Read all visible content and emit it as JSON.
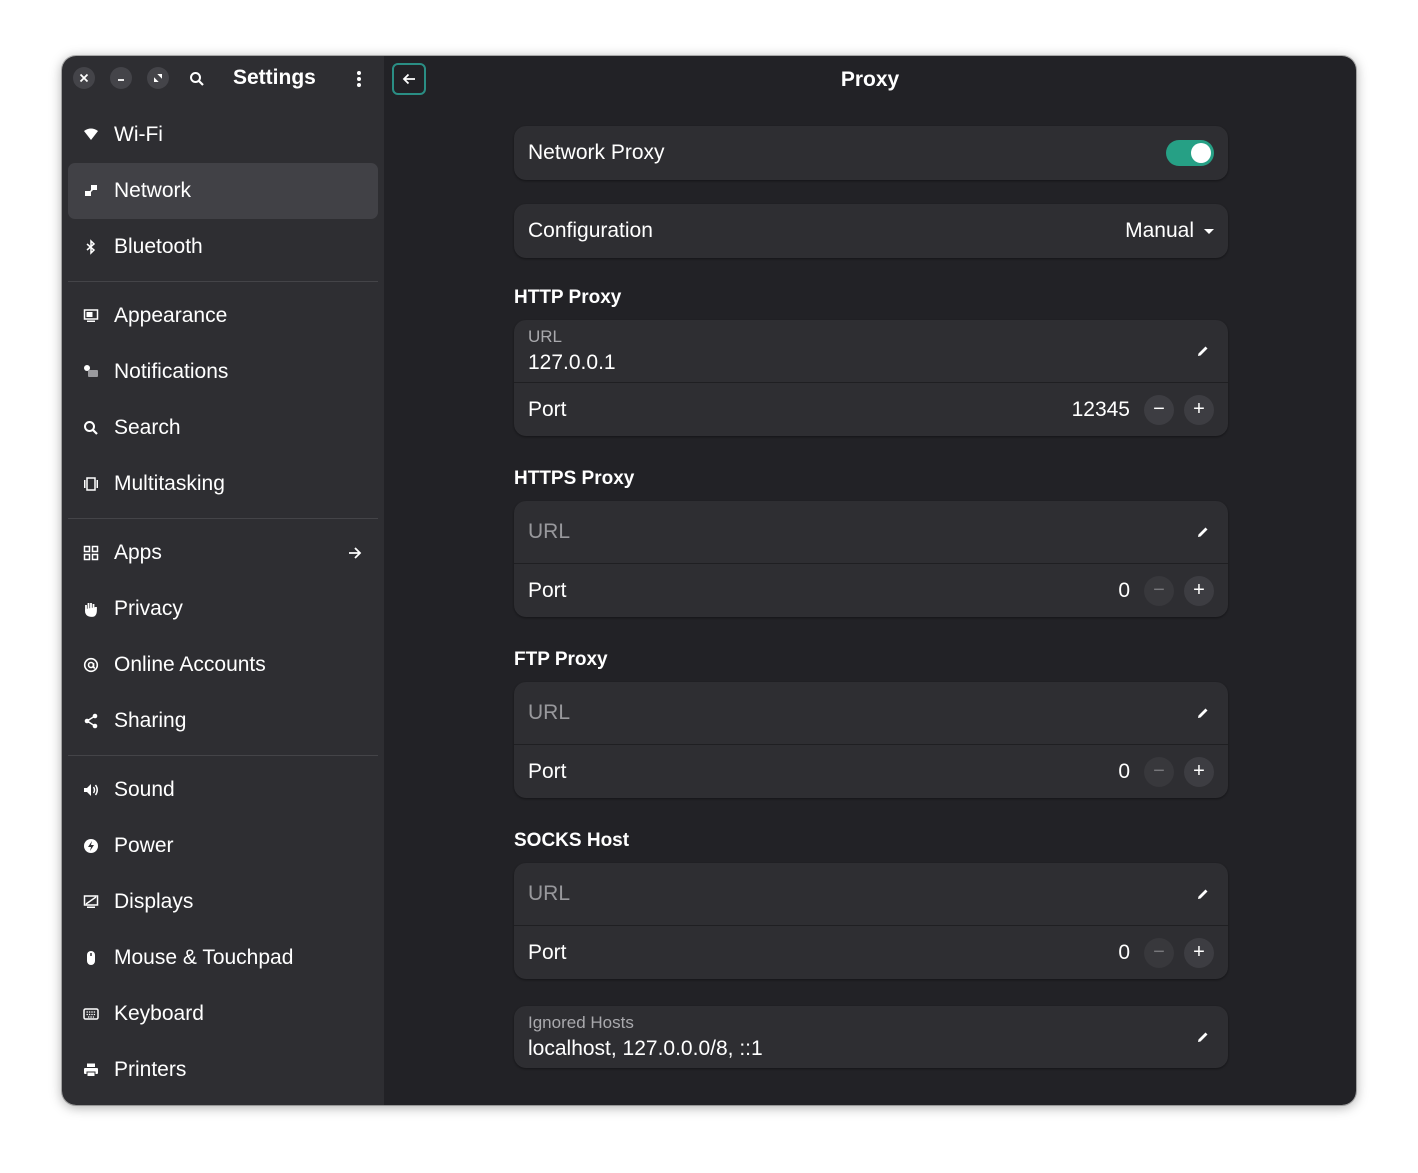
{
  "window": {
    "sidebar_title": "Settings",
    "page_title": "Proxy"
  },
  "sidebar": {
    "groups": [
      [
        {
          "label": "Wi-Fi",
          "icon": "wifi-icon"
        },
        {
          "label": "Network",
          "icon": "network-icon",
          "active": true
        },
        {
          "label": "Bluetooth",
          "icon": "bluetooth-icon"
        }
      ],
      [
        {
          "label": "Appearance",
          "icon": "appearance-icon"
        },
        {
          "label": "Notifications",
          "icon": "notifications-icon"
        },
        {
          "label": "Search",
          "icon": "search-icon"
        },
        {
          "label": "Multitasking",
          "icon": "multitasking-icon"
        }
      ],
      [
        {
          "label": "Apps",
          "icon": "apps-icon",
          "arrow": true
        },
        {
          "label": "Privacy",
          "icon": "privacy-icon"
        },
        {
          "label": "Online Accounts",
          "icon": "online-accounts-icon"
        },
        {
          "label": "Sharing",
          "icon": "sharing-icon"
        }
      ],
      [
        {
          "label": "Sound",
          "icon": "sound-icon"
        },
        {
          "label": "Power",
          "icon": "power-icon"
        },
        {
          "label": "Displays",
          "icon": "displays-icon"
        },
        {
          "label": "Mouse & Touchpad",
          "icon": "mouse-icon"
        },
        {
          "label": "Keyboard",
          "icon": "keyboard-icon"
        },
        {
          "label": "Printers",
          "icon": "printer-icon"
        }
      ]
    ]
  },
  "proxy": {
    "network_proxy_label": "Network Proxy",
    "network_proxy_enabled": true,
    "configuration_label": "Configuration",
    "configuration_value": "Manual",
    "http": {
      "title": "HTTP Proxy",
      "url_label": "URL",
      "url_value": "127.0.0.1",
      "port_label": "Port",
      "port_value": "12345"
    },
    "https": {
      "title": "HTTPS Proxy",
      "url_label": "URL",
      "url_value": "",
      "port_label": "Port",
      "port_value": "0"
    },
    "ftp": {
      "title": "FTP Proxy",
      "url_label": "URL",
      "url_value": "",
      "port_label": "Port",
      "port_value": "0"
    },
    "socks": {
      "title": "SOCKS Host",
      "url_label": "URL",
      "url_value": "",
      "port_label": "Port",
      "port_value": "0"
    },
    "ignored_hosts_label": "Ignored Hosts",
    "ignored_hosts_value": "localhost, 127.0.0.0/8, ::1",
    "spin_minus": "−",
    "spin_plus": "+"
  },
  "colors": {
    "accent": "#26a085",
    "sidebar_bg": "#2e2e32",
    "content_bg": "#222226",
    "card_bg": "#2e2e32"
  }
}
